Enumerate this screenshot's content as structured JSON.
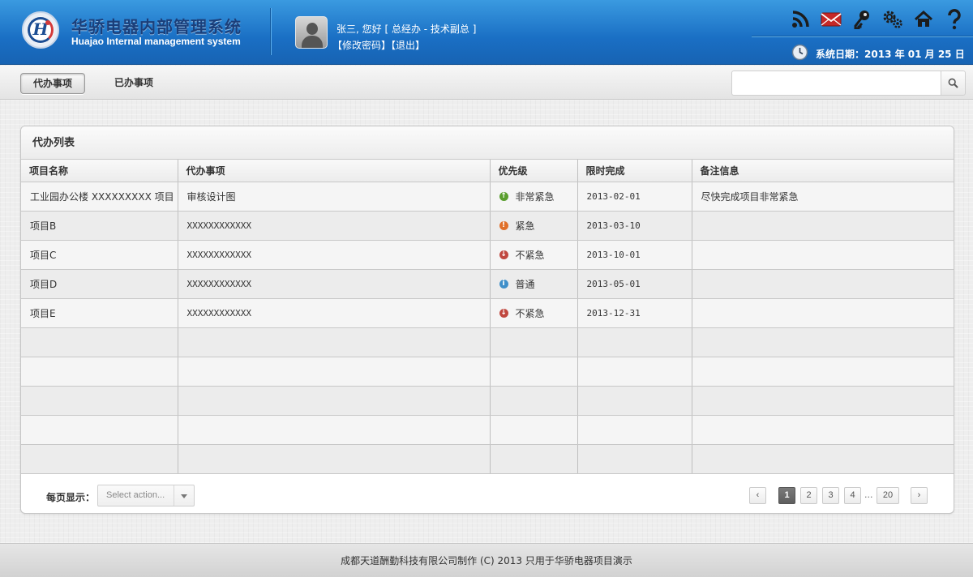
{
  "header": {
    "title": "华骄电器内部管理系统",
    "subtitle": "Huajao Internal management system",
    "logo_letter": "H",
    "greeting": "张三, 您好 [ 总经办 - 技术副总 ]",
    "change_password": "【修改密码】",
    "logout": "【退出】",
    "icons": [
      "rss-icon",
      "mail-icon",
      "key-icon",
      "settings-icon",
      "home-icon",
      "help-icon"
    ],
    "date_label": "系统日期：",
    "date_value": "2013 年 01 月 25 日"
  },
  "toolbar": {
    "tabs": [
      "代办事项",
      "已办事项"
    ],
    "active_tab": 0,
    "search_placeholder": "",
    "search_icon": "search-icon"
  },
  "panel": {
    "title": "代办列表",
    "columns": [
      "项目名称",
      "代办事项",
      "优先级",
      "限时完成",
      "备注信息"
    ],
    "rows": [
      {
        "name": "工业园办公楼 XXXXXXXXX 项目",
        "task": "审核设计图",
        "priority": "非常紧急",
        "priority_icon": "up",
        "deadline": "2013-02-01",
        "note": "尽快完成项目非常紧急"
      },
      {
        "name": "项目B",
        "task": "XXXXXXXXXXXX",
        "priority": "紧急",
        "priority_icon": "warn",
        "deadline": "2013-03-10",
        "note": ""
      },
      {
        "name": "项目C",
        "task": "XXXXXXXXXXXX",
        "priority": "不紧急",
        "priority_icon": "down",
        "deadline": "2013-10-01",
        "note": ""
      },
      {
        "name": "项目D",
        "task": "XXXXXXXXXXXX",
        "priority": "普通",
        "priority_icon": "info",
        "deadline": "2013-05-01",
        "note": ""
      },
      {
        "name": "项目E",
        "task": "XXXXXXXXXXXX",
        "priority": "不紧急",
        "priority_icon": "down",
        "deadline": "2013-12-31",
        "note": ""
      },
      {
        "name": "",
        "task": "",
        "priority": "",
        "priority_icon": "",
        "deadline": "",
        "note": ""
      },
      {
        "name": "",
        "task": "",
        "priority": "",
        "priority_icon": "",
        "deadline": "",
        "note": ""
      },
      {
        "name": "",
        "task": "",
        "priority": "",
        "priority_icon": "",
        "deadline": "",
        "note": ""
      },
      {
        "name": "",
        "task": "",
        "priority": "",
        "priority_icon": "",
        "deadline": "",
        "note": ""
      },
      {
        "name": "",
        "task": "",
        "priority": "",
        "priority_icon": "",
        "deadline": "",
        "note": ""
      }
    ],
    "priority_colors": {
      "up": "#5a9e2e",
      "warn": "#e0702a",
      "down": "#c0473f",
      "info": "#3f8fc9"
    }
  },
  "pager": {
    "per_page_label": "每页显示：",
    "select_placeholder": "Select action...",
    "prev": "‹",
    "pages": [
      "1",
      "2",
      "3",
      "4"
    ],
    "ellipsis": "...",
    "last": "20",
    "next": "›",
    "current": "1"
  },
  "footer": {
    "text": "成都天道酬勤科技有限公司制作 (C) 2013 只用于华骄电器项目演示"
  }
}
